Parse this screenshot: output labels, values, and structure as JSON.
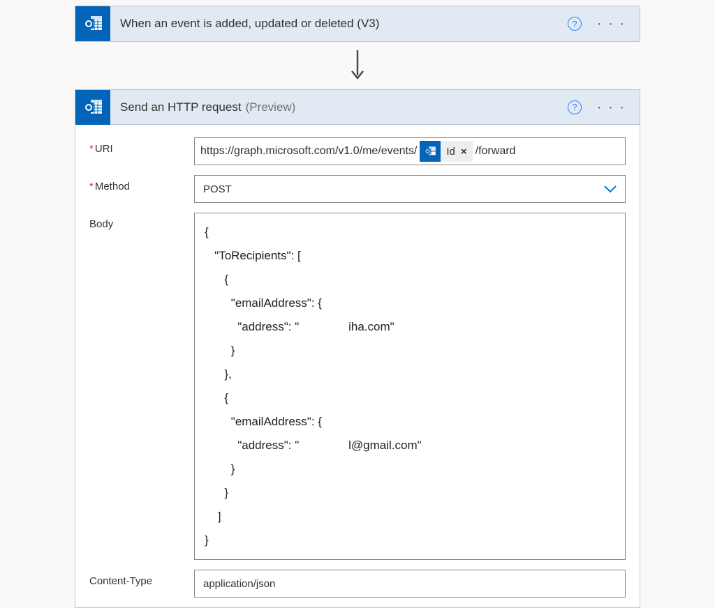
{
  "trigger": {
    "title": "When an event is added, updated or deleted (V3)"
  },
  "action": {
    "title": "Send an HTTP request",
    "preview": "(Preview)",
    "fields": {
      "uri_label": "URI",
      "uri_prefix": "https://graph.microsoft.com/v1.0/me/events/",
      "uri_token": "Id",
      "uri_suffix": "/forward",
      "method_label": "Method",
      "method_value": "POST",
      "body_label": "Body",
      "body_value": "{\n   \"ToRecipients\": [\n      {\n        \"emailAddress\": {\n          \"address\": \"               iha.com\"\n        }\n      },\n      {\n        \"emailAddress\": {\n          \"address\": \"               l@gmail.com\"\n        }\n      }\n    ]\n}",
      "content_type_label": "Content-Type",
      "content_type_value": "application/json"
    }
  },
  "glyphs": {
    "help": "?",
    "close": "×"
  }
}
